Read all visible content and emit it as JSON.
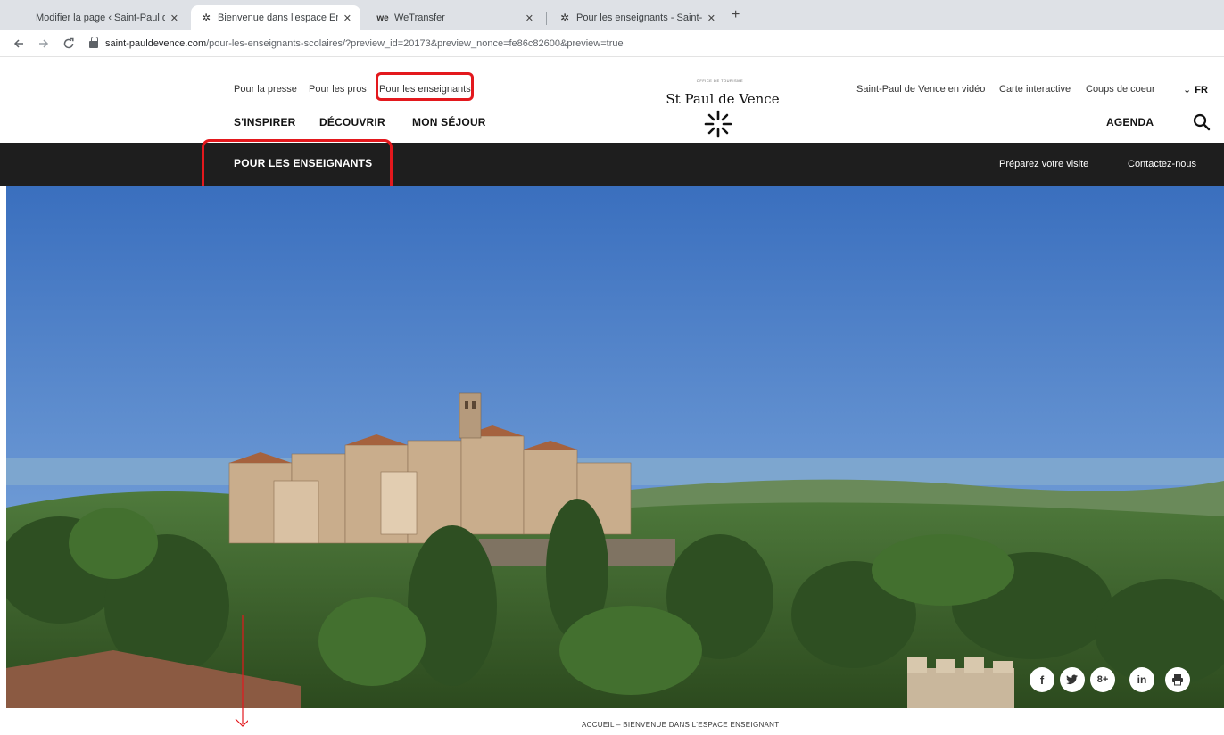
{
  "browser": {
    "tabs": [
      {
        "title": "Modifier la page ‹ Saint-Paul de \\",
        "close": "✕",
        "icon": ""
      },
      {
        "title": "Bienvenue dans l'espace Enseign",
        "close": "✕",
        "icon": "✲"
      },
      {
        "title": "WeTransfer",
        "close": "✕",
        "icon": "we"
      },
      {
        "title": "Pour les enseignants - Saint-Paul",
        "close": "✕",
        "icon": "✲"
      }
    ],
    "new_tab": "+",
    "url_domain": "saint-pauldevence.com",
    "url_path": "/pour-les-enseignants-scolaires/?preview_id=20173&preview_nonce=fe86c82600&preview=true"
  },
  "header": {
    "utility_left": [
      "Pour la presse",
      "Pour les pros",
      "Pour les enseignants"
    ],
    "utility_right": [
      "Saint-Paul de Vence en vidéo",
      "Carte interactive",
      "Coups de coeur"
    ],
    "language": "FR",
    "main_nav": [
      "S'INSPIRER",
      "DÉCOUVRIR",
      "MON SÉJOUR"
    ],
    "agenda": "AGENDA",
    "logo": {
      "tagline": "OFFICE DE TOURISME",
      "name": "St Paul de Vence"
    }
  },
  "section_bar": {
    "title": "POUR LES ENSEIGNANTS",
    "links": [
      "Préparez votre visite",
      "Contactez-nous"
    ]
  },
  "share": [
    "f",
    "t",
    "8+",
    "in",
    "print"
  ],
  "breadcrumb": "ACCUEIL – BIENVENUE DANS L'ESPACE ENSEIGNANT",
  "colors": {
    "highlight": "#e3181d",
    "section_bar": "#1e1e1e"
  }
}
